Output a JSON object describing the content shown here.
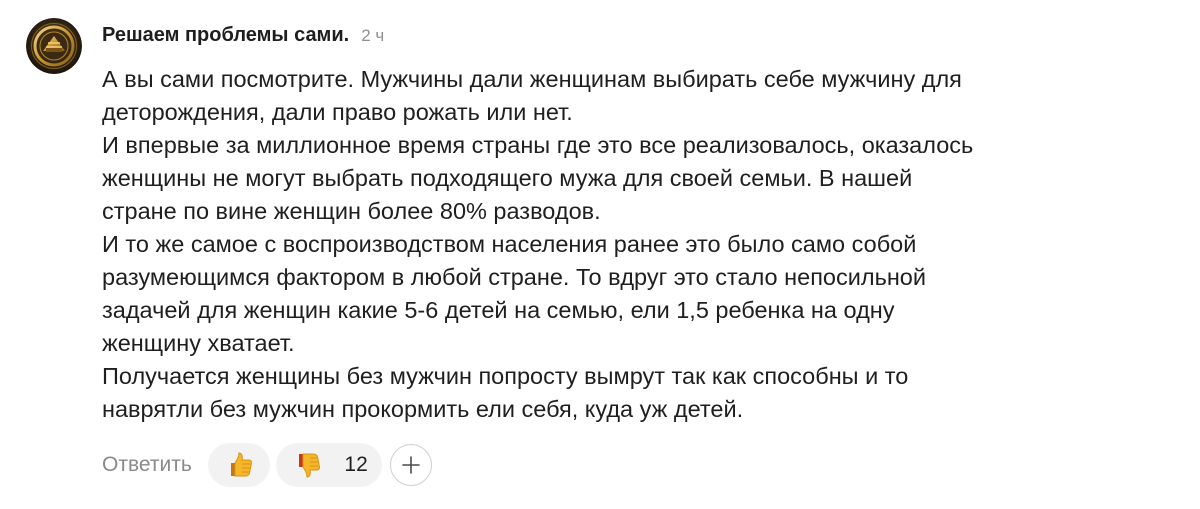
{
  "comment": {
    "author": "Решаем проблемы сами.",
    "time": "2 ч",
    "paragraphs": [
      "А вы сами посмотрите. Мужчины дали женщинам выбирать себе мужчину для\nдеторождения, дали право рожать или нет.",
      "И впервые за миллионное время страны где это все реализовалось, оказалось\nженщины не могут выбрать подходящего мужа для своей семьи. В нашей\nстране по вине женщин более 80% разводов.",
      "И то же самое с воспроизводством населения ранее это было само собой\nразумеющимся фактором в любой стране. То вдруг это стало непосильной\nзадачей для женщин какие 5-6 детей на семью, ели 1,5 ребенка на одну\nженщину хватает.",
      "Получается женщины без мужчин попросту вымрут так как способны и то\nнаврятли без мужчин прокормить ели себя, куда уж детей."
    ],
    "actions": {
      "reply_label": "Ответить",
      "like_icon": "thumbs-up-emoji-icon",
      "dislike_icon": "thumbs-down-emoji-icon",
      "dislike_count": "12",
      "add_reaction_icon": "plus-icon"
    }
  },
  "colors": {
    "text": "#1f1f1f",
    "muted": "#8a8a8a",
    "pill_bg": "#f2f2f2",
    "emoji_yellow": "#f5b62a",
    "emoji_red": "#d64a2a"
  }
}
